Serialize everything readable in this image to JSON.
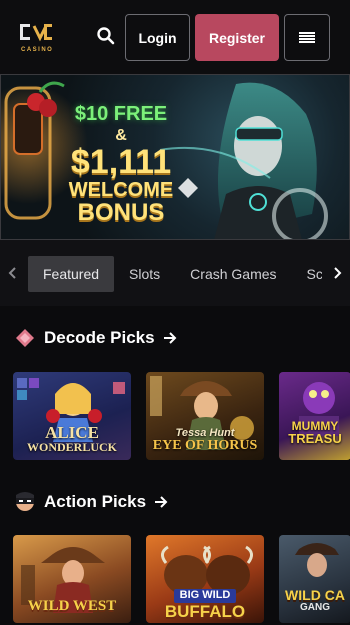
{
  "header": {
    "logo_text": "CASINO",
    "login_label": "Login",
    "register_label": "Register"
  },
  "banner": {
    "line1": "$10 FREE",
    "line2": "&",
    "line3": "$1,111",
    "line4": "WELCOME",
    "line5": "BONUS"
  },
  "tabs": [
    {
      "label": "Featured",
      "active": true
    },
    {
      "label": "Slots",
      "active": false
    },
    {
      "label": "Crash Games",
      "active": false
    },
    {
      "label": "Scr",
      "active": false
    }
  ],
  "sections": [
    {
      "title": "Decode Picks",
      "games": [
        {
          "title_a": "ALICE",
          "title_b": "WONDERLUCK"
        },
        {
          "title_a": "Tessa Hunt",
          "title_b": "EYE OF HORUS"
        },
        {
          "title_a": "MUMMY",
          "title_b": "TREASU"
        }
      ]
    },
    {
      "title": "Action Picks",
      "games": [
        {
          "title_a": "",
          "title_b": "WILD WEST"
        },
        {
          "title_a": "BIG WILD",
          "title_b": "BUFFALO"
        },
        {
          "title_a": "WILD CA",
          "title_b": "GANG"
        }
      ]
    }
  ],
  "colors": {
    "background": "#0b0b0d",
    "register": "#b8485f",
    "tab_active": "#3a3a3e",
    "accent_gold": "#ffe27a",
    "accent_green": "#7cf07a"
  }
}
